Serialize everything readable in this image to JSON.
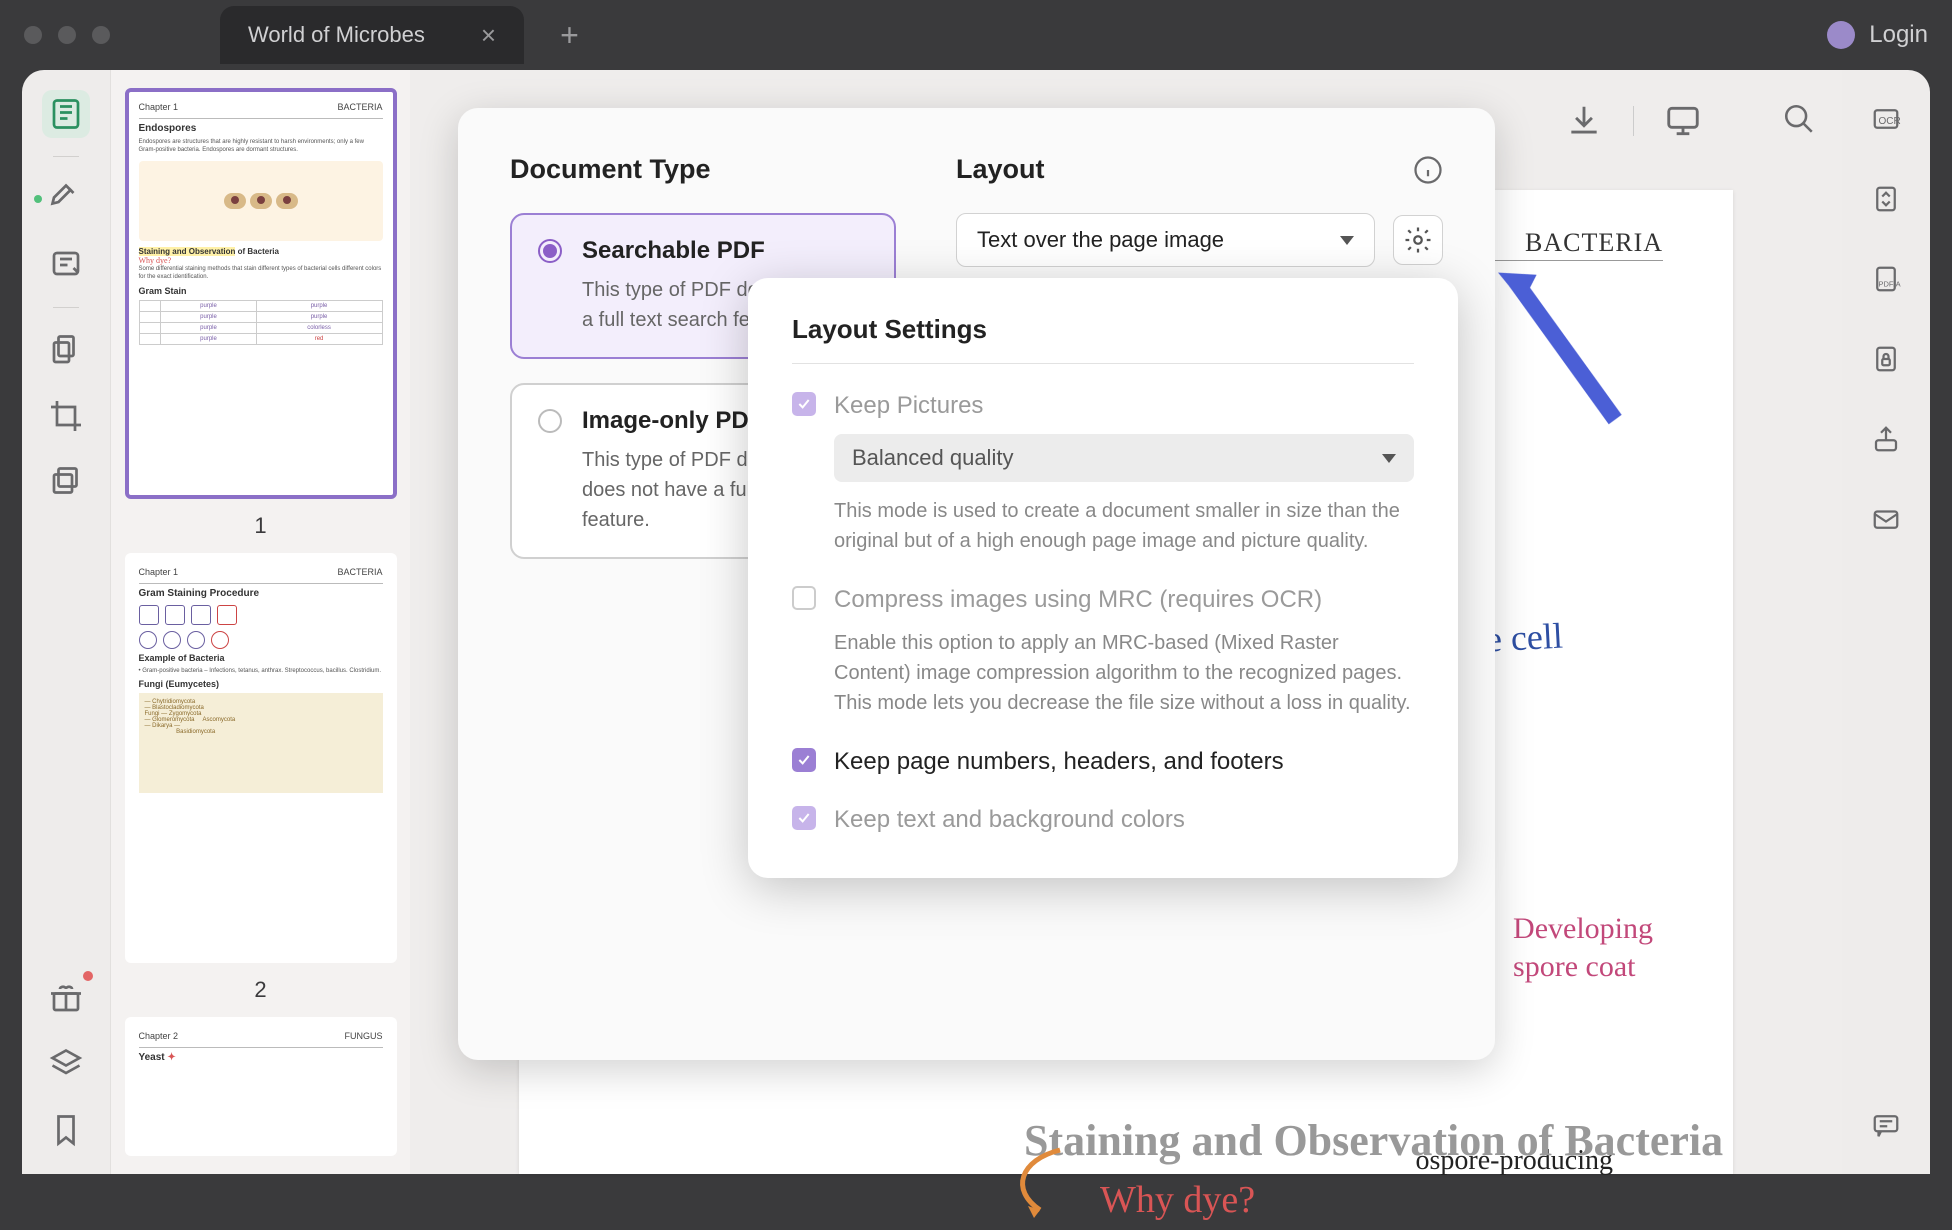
{
  "titlebar": {
    "tab_title": "World of Microbes",
    "login_label": "Login"
  },
  "thumbnails": {
    "page1_label": "1",
    "page2_label": "2",
    "page1": {
      "chapter": "Chapter 1",
      "header_right": "BACTERIA",
      "h1": "Endospores",
      "hl1": "Staining and Observation",
      "hl1_after": " of Bacteria",
      "why": "Why dye?",
      "gram": "Gram Stain"
    },
    "page2": {
      "chapter": "Chapter 1",
      "header_right": "BACTERIA",
      "h1": "Gram Staining Procedure",
      "h2": "Example of Bacteria",
      "h3": "Fungi (Eumycetes)"
    }
  },
  "document": {
    "header_right": "BACTERIA",
    "hand_vegetative": "vegetative cell",
    "hand_developing": "Developing\nspore coat",
    "spore_text": "ospore-producing",
    "staining_title": "Staining and Observation of Bacteria",
    "why_dye": "Why dye?"
  },
  "dialog": {
    "doc_type_title": "Document Type",
    "layout_title": "Layout",
    "searchable": {
      "title": "Searchable PDF",
      "desc": "This type of PDF document has a full text search feature."
    },
    "image_only": {
      "title": "Image-only PDF",
      "desc": "This type of PDF document does not have a full text search feature."
    },
    "layout_select": "Text over the page image"
  },
  "settings": {
    "title": "Layout Settings",
    "keep_pictures": "Keep Pictures",
    "quality_select": "Balanced quality",
    "quality_help": "This mode is used to create a document smaller in size than the original but of a high enough page image and picture quality.",
    "compress_mrc": "Compress images using MRC (requires OCR)",
    "compress_help": "Enable this option to apply an MRC-based (Mixed Raster Content) image compression algorithm to the recognized pages. This mode lets you decrease the file size without a loss in quality.",
    "keep_headers": "Keep page numbers, headers, and footers",
    "keep_colors": "Keep text and background colors"
  }
}
